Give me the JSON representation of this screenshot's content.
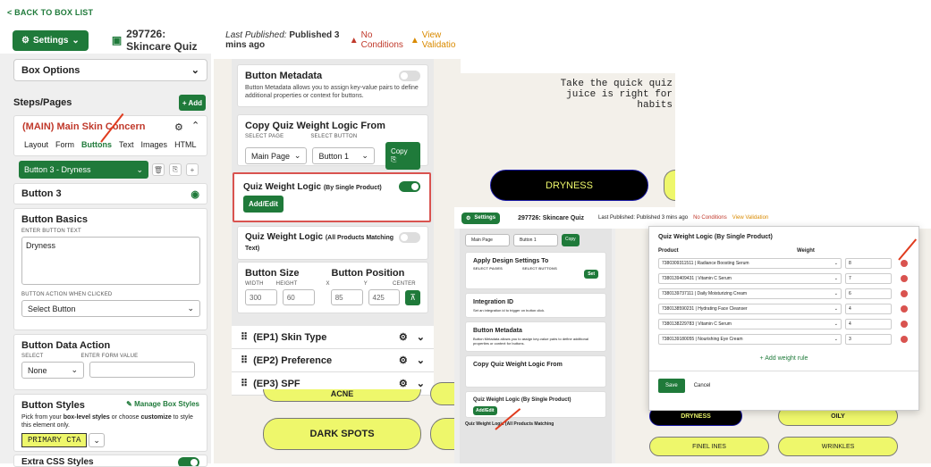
{
  "nav": {
    "back": "< BACK TO BOX LIST"
  },
  "topbar": {
    "settings": "Settings",
    "quiz_title": "297726: Skincare Quiz",
    "published_label": "Last Published:",
    "published_value": "Published 3 mins ago",
    "no_conditions": "No Conditions",
    "view_validation": "View Validatio"
  },
  "left": {
    "box_options": "Box Options",
    "steps_pages": "Steps/Pages",
    "add": "+ Add",
    "main_step": "(MAIN) Main Skin Concern",
    "tabs": [
      "Layout",
      "Form",
      "Buttons",
      "Text",
      "Images",
      "HTML"
    ],
    "button_select": "Button 3 - Dryness",
    "button_name": "Button 3",
    "basics_title": "Button Basics",
    "enter_text_label": "ENTER BUTTON TEXT",
    "button_text": "Dryness",
    "action_label": "BUTTON ACTION WHEN CLICKED",
    "action_value": "Select Button",
    "data_action_title": "Button Data Action",
    "select_label": "SELECT",
    "form_value_label": "ENTER FORM VALUE",
    "data_action_value": "None",
    "styles_title": "Button Styles",
    "manage_styles": "Manage Box Styles",
    "styles_desc1": "Pick from your",
    "styles_desc_bold": "box-level styles",
    "styles_desc2": "or choose",
    "styles_desc_bold2": "customize",
    "styles_desc3": "to style this element only.",
    "style_value": "PRIMARY CTA",
    "extra_css": "Extra CSS Styles"
  },
  "mid": {
    "meta_title": "Button Metadata",
    "meta_desc": "Button Metadata allows you to assign key-value pairs to define additional properties or context for buttons.",
    "copy_title": "Copy Quiz Weight Logic From",
    "select_page_label": "SELECT PAGE",
    "select_button_label": "SELECT BUTTON",
    "page_value": "Main Page",
    "button_value": "Button 1",
    "copy_btn": "Copy",
    "qw_single_title": "Quiz Weight Logic",
    "qw_single_sub": "(By Single Product)",
    "add_edit": "Add/Edit",
    "qw_all_title": "Quiz Weight Logic",
    "qw_all_sub": "(All Products Matching Text)",
    "size_title": "Button Size",
    "pos_title": "Button Position",
    "width_label": "WIDTH",
    "height_label": "HEIGHT",
    "x_label": "X",
    "y_label": "Y",
    "center_label": "CENTER",
    "width": "300",
    "height": "60",
    "x": "85",
    "y": "425",
    "steps": [
      "(EP1) Skin Type",
      "(EP2) Preference",
      "(EP3) SPF"
    ],
    "acne": "ACNE",
    "dark_spots": "DARK SPOTS"
  },
  "preview": {
    "quiz_line1": "Take the quick quiz",
    "quiz_line2": "juice is right for",
    "quiz_line3": "habits",
    "dryness": "DRYNESS"
  },
  "inset": {
    "settings": "Settings",
    "quiz_title": "297726: Skincare Quiz",
    "published": "Last Published: Published 3 mins ago",
    "no_conditions": "No Conditions",
    "view_validation": "View Validation",
    "main_page": "Main Page",
    "button1": "Button 1",
    "copy": "Copy",
    "apply_design": "Apply Design Settings To",
    "select_pages": "SELECT PAGES",
    "select_buttons": "SELECT BUTTONS",
    "set": "Set",
    "integration_id": "Integration ID",
    "integration_desc": "Set an integration id to trigger on button click.",
    "button_metadata": "Button Metadata",
    "metadata_desc": "Button Metadata allows you to assign key-value pairs to define additional properties or context for buttons.",
    "copy_logic": "Copy Quiz Weight Logic From",
    "qw_single": "Quiz Weight Logic (By Single Product)",
    "add_edit": "Add/Edit",
    "qw_all": "Quiz Weight Logic (All Products Matching",
    "modal_title": "Quiz Weight Logic (By Single Product)",
    "col_product": "Product",
    "col_weight": "Weight",
    "rows": [
      {
        "product": "7380309311511 | Radiance Boosting Serum",
        "weight": "8"
      },
      {
        "product": "7380139409431 | Vitamin C Serum",
        "weight": "7"
      },
      {
        "product": "7380139737111 | Daily Moisturizing Cream",
        "weight": "6"
      },
      {
        "product": "7380138590231 | Hydrating Face Cleanser",
        "weight": "4"
      },
      {
        "product": "7380138229783 | Vitamin C Serum",
        "weight": "4"
      },
      {
        "product": "7380139180055 | Nourishing Eye Cream",
        "weight": "3"
      }
    ],
    "add_rule": "+ Add weight rule",
    "save": "Save",
    "cancel": "Cancel",
    "dryness": "DRYNESS",
    "oily": "OILY",
    "fine_lines": "FINEL INES",
    "wrinkles": "WRINKLES"
  },
  "colors": {
    "brand": "#1f7a3a",
    "accent": "#eef76b",
    "alert": "#d9534f"
  }
}
